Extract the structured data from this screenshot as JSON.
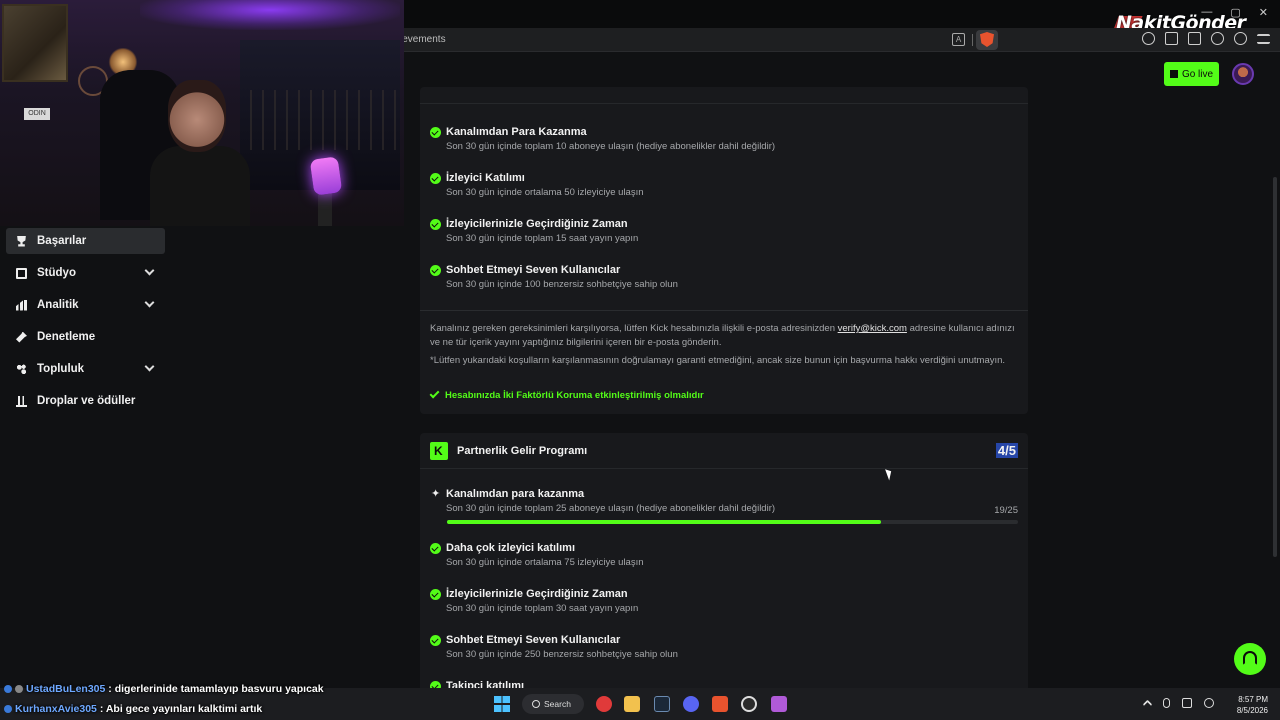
{
  "browser": {
    "url_fragment": "ievements",
    "watermark": "NakitGönder",
    "win_controls": [
      "—",
      "▢",
      "✕"
    ]
  },
  "header": {
    "go_live_label": "Go live",
    "brand_color": "#53fc18"
  },
  "sidebar": {
    "items": [
      {
        "label": "Başarılar",
        "icon": "trophy-icon",
        "active": true,
        "expandable": false
      },
      {
        "label": "Stüdyo",
        "icon": "studio-icon",
        "active": false,
        "expandable": true
      },
      {
        "label": "Analitik",
        "icon": "analytics-icon",
        "active": false,
        "expandable": true
      },
      {
        "label": "Denetleme",
        "icon": "wrench-icon",
        "active": false,
        "expandable": false
      },
      {
        "label": "Topluluk",
        "icon": "community-icon",
        "active": false,
        "expandable": true
      },
      {
        "label": "Droplar ve ödüller",
        "icon": "drops-icon",
        "active": false,
        "expandable": false
      }
    ]
  },
  "affiliate_card": {
    "requirements": [
      {
        "title": "Kanalımdan Para Kazanma",
        "desc": "Son 30 gün içinde toplam 10 aboneye ulaşın (hediye abonelikler dahil değildir)",
        "done": true
      },
      {
        "title": "İzleyici Katılımı",
        "desc": "Son 30 gün içinde ortalama 50 izleyiciye ulaşın",
        "done": true
      },
      {
        "title": "İzleyicilerinizle Geçirdiğiniz Zaman",
        "desc": "Son 30 gün içinde toplam 15 saat yayın yapın",
        "done": true
      },
      {
        "title": "Sohbet Etmeyi Seven Kullanıcılar",
        "desc": "Son 30 gün içinde 100 benzersiz sohbetçiye sahip olun",
        "done": true
      }
    ],
    "note_part1": "Kanalınız gereken gereksinimleri karşılıyorsa, lütfen Kick hesabınızla ilişkili e-posta adresinizden ",
    "note_email": "verify@kick.com",
    "note_part2": " adresine kullanıcı adınızı ve ne tür içerik yayını yaptığınız bilgilerini içeren bir e-posta gönderin.",
    "disclaimer": "*Lütfen yukarıdaki koşulların karşılanmasının doğrulamayı garanti etmediğini, ancak size bunun için başvurma hakkı verdiğini unutmayın.",
    "twofa": "Hesabınızda İki Faktörlü Koruma etkinleştirilmiş olmalıdır"
  },
  "partner_card": {
    "title": "Partnerlik Gelir Programı",
    "score": "4/5",
    "progress_item": {
      "title": "Kanalımdan para kazanma",
      "desc": "Son 30 gün içinde toplam 25 aboneye ulaşın (hediye abonelikler dahil değildir)",
      "progress_text": "19/25",
      "progress_fraction": 0.76
    },
    "requirements": [
      {
        "title": "Daha çok izleyici katılımı",
        "desc": "Son 30 gün içinde ortalama 75 izleyiciye ulaşın",
        "done": true
      },
      {
        "title": "İzleyicilerinizle Geçirdiğiniz Zaman",
        "desc": "Son 30 gün içinde toplam 30 saat yayın yapın",
        "done": true
      },
      {
        "title": "Sohbet Etmeyi Seven Kullanıcılar",
        "desc": "Son 30 gün içinde 250 benzersiz sohbetçiye sahip olun",
        "done": true
      },
      {
        "title": "Takipçi katılımı",
        "desc": "",
        "done": true
      }
    ]
  },
  "chat": [
    {
      "user": "UstadBuLen305",
      "message": ": digerlerinide tamamlayıp basvuru yapıcak"
    },
    {
      "user": "KurhanxAvie305",
      "message": ": Abi gece yayınları kalktimi artık"
    }
  ],
  "taskbar": {
    "search_label": "Search",
    "time": "8:57 PM",
    "date": "8/5/2026"
  },
  "webcam": {
    "sign_text": "ODIN"
  }
}
